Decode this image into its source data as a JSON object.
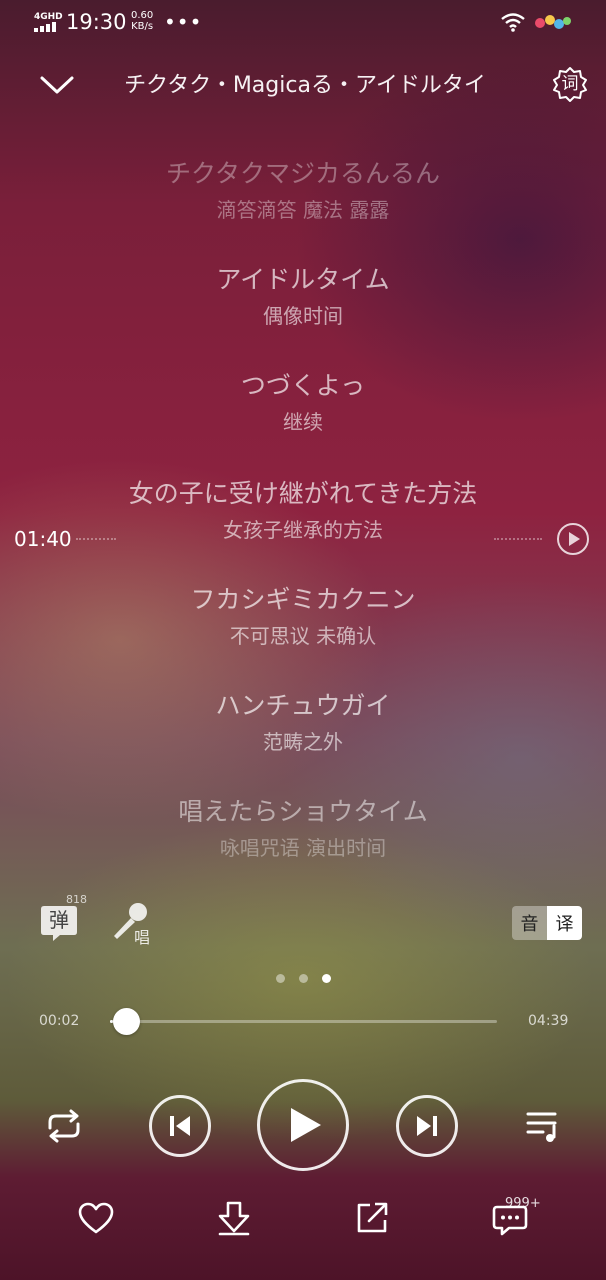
{
  "status_bar": {
    "network": "4GHD",
    "time": "19:30",
    "speed_value": "0.60",
    "speed_unit": "KB/s",
    "overflow": "•••"
  },
  "header": {
    "title": "チクタク・Magicaる・アイドルタイ",
    "lyrics_button_label": "词"
  },
  "lyrics": [
    {
      "ja": "チクタクマジカるんるん",
      "zh": "滴答滴答 魔法 露露"
    },
    {
      "ja": "アイドルタイム",
      "zh": "偶像时间"
    },
    {
      "ja": "つづくよっ",
      "zh": "继续"
    },
    {
      "ja": "女の子に受け継がれてきた方法",
      "zh": "女孩子继承的方法"
    },
    {
      "ja": "フカシギミカクニン",
      "zh": "不可思议 未确认"
    },
    {
      "ja": "ハンチュウガイ",
      "zh": "范畴之外"
    },
    {
      "ja": "唱えたらショウタイム",
      "zh": "咏唱咒语 演出时间"
    }
  ],
  "lyric_seek_time": "01:40",
  "tools": {
    "danmu_label": "弹",
    "danmu_count": "818",
    "sing_label": "唱",
    "toggle_a": "音",
    "toggle_b": "译"
  },
  "pager": {
    "total": 3,
    "active_index": 2
  },
  "progress": {
    "current": "00:02",
    "total": "04:39",
    "fraction": 0.007
  },
  "comment_count": "999+",
  "colors": {
    "accent": "#ffffff",
    "progress_track": "#b58aa0"
  }
}
